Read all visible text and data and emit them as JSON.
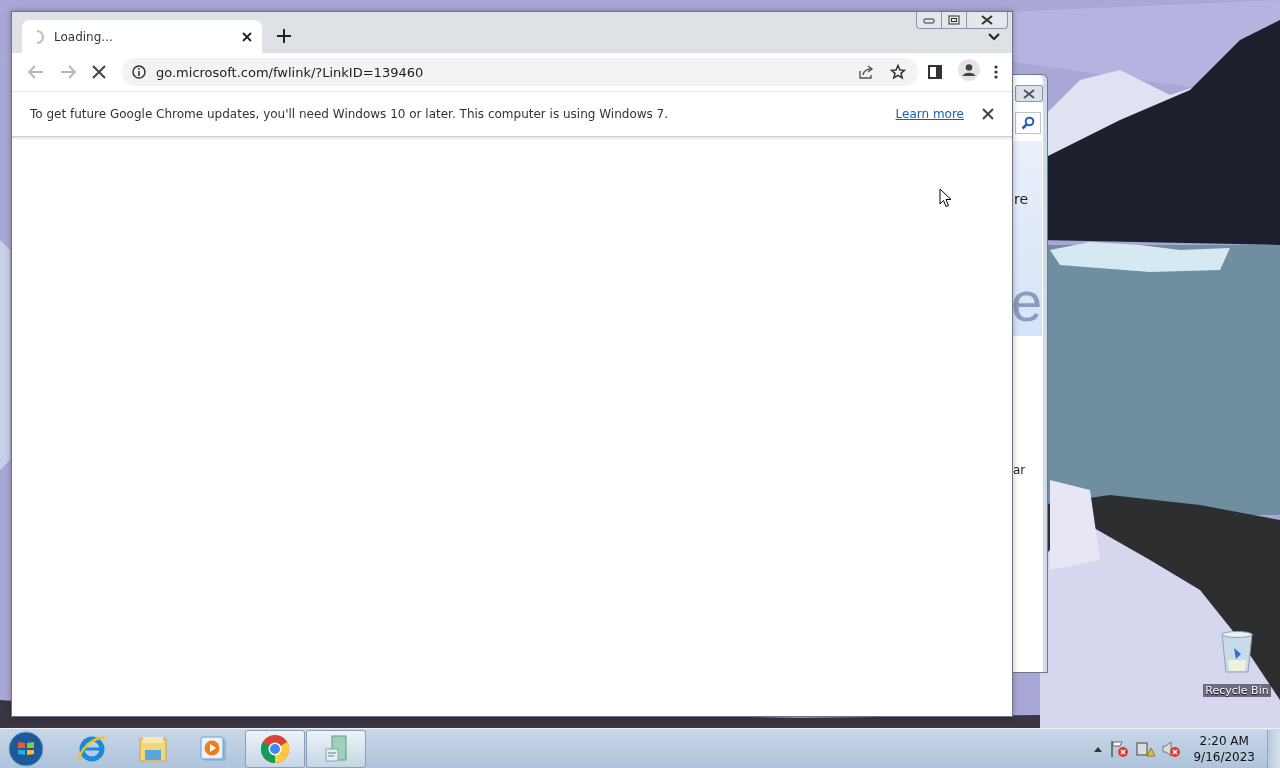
{
  "browser": {
    "tabs": [
      {
        "title": "Loading...",
        "selected": true,
        "loading": true
      }
    ],
    "loading": true,
    "address": "go.microsoft.com/fwlink/?LinkID=139460",
    "infobar": {
      "message": "To get future Google Chrome updates, you'll need Windows 10 or later. This computer is using Windows 7.",
      "link": "Learn more"
    }
  },
  "background_window": {
    "texts": [
      "re",
      "e",
      "ar"
    ]
  },
  "desktop": {
    "icons": [
      {
        "label": "Recycle Bin"
      }
    ]
  },
  "taskbar": {
    "items": [
      {
        "kind": "ie",
        "running": false
      },
      {
        "kind": "explorer",
        "running": false
      },
      {
        "kind": "media",
        "running": false
      },
      {
        "kind": "chrome",
        "running": true
      },
      {
        "kind": "document",
        "running": true
      }
    ],
    "clock": {
      "time": "2:20 AM",
      "date": "9/16/2023"
    }
  }
}
